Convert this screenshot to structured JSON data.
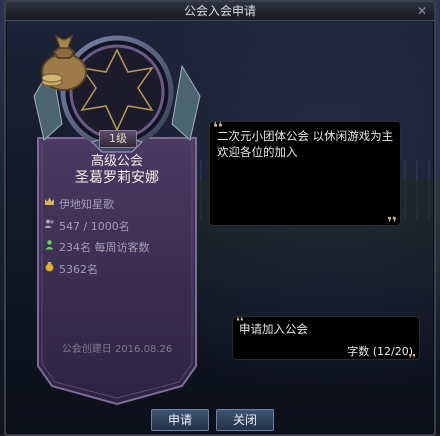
{
  "window": {
    "title": "公会入会申请"
  },
  "guild": {
    "level": "1级",
    "rank": "高级公会",
    "name": "圣葛罗莉安娜",
    "leader": "伊地知星歌",
    "members": "547 / 1000名",
    "weekly_visitors": "234名 每周访客数",
    "funds": "5362名",
    "founded": "公会创建日 2016.08.26",
    "emblem_icon": "money-bag-icon"
  },
  "description": {
    "text": "二次元小团体公会 以休闲游戏为主 欢迎各位的加入"
  },
  "application": {
    "message": "申请加入公会",
    "char_count": "字数 (12/20)"
  },
  "buttons": {
    "apply": "申请",
    "close": "关闭"
  },
  "colors": {
    "banner": "#3a2c4e",
    "accent": "#c9b893",
    "button": "#3f5572"
  }
}
